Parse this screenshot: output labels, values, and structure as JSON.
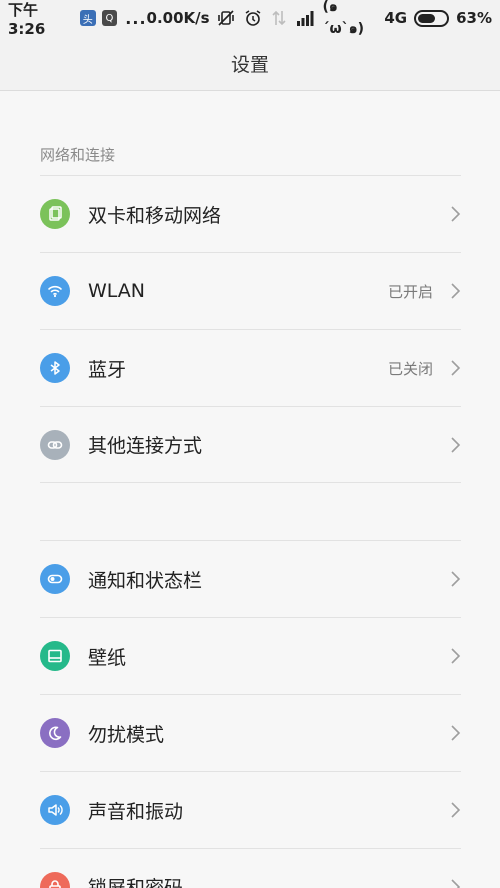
{
  "status_bar": {
    "time": "下午3:26",
    "app_icon_1": "头",
    "app_icon_2": "Q",
    "more": "...",
    "speed": "0.00K/s",
    "face": "(๑´ω`๑)",
    "network": "4G",
    "battery_percent": "63%",
    "battery_level": 0.63,
    "icons": [
      "vibrate-off-icon",
      "alarm-icon",
      "data-arrows-icon",
      "signal-icon",
      "battery-icon"
    ]
  },
  "header": {
    "title": "设置"
  },
  "section_network": {
    "label": "网络和连接",
    "items": [
      {
        "label": "双卡和移动网络",
        "status": "",
        "icon": "sim-card-icon",
        "color": "#7bc25a"
      },
      {
        "label": "WLAN",
        "status": "已开启",
        "icon": "wifi-icon",
        "color": "#4a9ee8"
      },
      {
        "label": "蓝牙",
        "status": "已关闭",
        "icon": "bluetooth-icon",
        "color": "#4a9ee8"
      },
      {
        "label": "其他连接方式",
        "status": "",
        "icon": "link-icon",
        "color": "#a8b1ba"
      }
    ]
  },
  "section_personal": {
    "items": [
      {
        "label": "通知和状态栏",
        "status": "",
        "icon": "toggle-icon",
        "color": "#4a9ee8"
      },
      {
        "label": "壁纸",
        "status": "",
        "icon": "wallpaper-icon",
        "color": "#25b98a"
      },
      {
        "label": "勿扰模式",
        "status": "",
        "icon": "moon-icon",
        "color": "#8a6fc2"
      },
      {
        "label": "声音和振动",
        "status": "",
        "icon": "speaker-icon",
        "color": "#4a9ee8"
      },
      {
        "label": "锁屏和密码",
        "status": "",
        "icon": "lock-icon",
        "color": "#ee6a5a"
      }
    ]
  }
}
